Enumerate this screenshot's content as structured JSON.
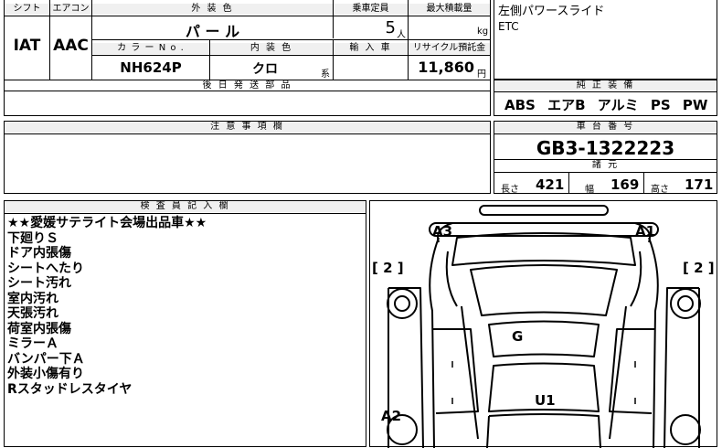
{
  "spec": {
    "shift_label": "シフト",
    "aircon_label": "エアコン",
    "exterior_color_label": "外 装 色",
    "capacity_label": "乗車定員",
    "max_load_label": "最大積載量",
    "shift_value": "IAT",
    "aircon_value": "AAC",
    "exterior_color_value": "パ ー ル",
    "capacity_value": "5",
    "capacity_unit": "人",
    "max_load_unit": "kg",
    "color_no_label": "カ ラ ー N o .",
    "interior_color_label": "内 装 色",
    "import_label": "輸 入 車",
    "recycle_label": "リサイクル預託金",
    "color_no_value": "NH624P",
    "interior_color_value": "クロ",
    "interior_suffix": "系",
    "recycle_value": "11,860",
    "recycle_unit": "円",
    "later_parts_label": "後 日 発 送 部 品"
  },
  "options_note": {
    "line1": "左側パワースライド",
    "line2": "ETC"
  },
  "genuine_equipment": {
    "label": "純 正 装 備",
    "items": [
      "ABS",
      "エアB",
      "アルミ",
      "PS",
      "PW"
    ]
  },
  "notes": {
    "label": "注 意 事 項 欄"
  },
  "chassis": {
    "label": "車 台 番 号",
    "number": "GB3-1322223",
    "dims_label": "諸 元",
    "length_label": "長さ",
    "length_value": "421",
    "width_label": "幅",
    "width_value": "169",
    "height_label": "高さ",
    "height_value": "171"
  },
  "inspector": {
    "label": "検 査 員 記 入 欄",
    "lines": [
      "★★愛媛サテライト会場出品車★★",
      "下廻りＳ",
      "ドア内張傷",
      "シートへたり",
      "シート汚れ",
      "室内汚れ",
      "天張汚れ",
      "荷室内張傷",
      "ミラーＡ",
      "バンパー下Ａ",
      "外装小傷有り",
      "Rスタッドレスタイヤ"
    ]
  },
  "diagram": {
    "marks": {
      "front_left": "A3",
      "front_right": "A1",
      "roof": "G",
      "rear_center": "U1",
      "rear_left": "A2",
      "door_left": "[ 2 ]",
      "door_right": "[ 2 ]"
    }
  }
}
